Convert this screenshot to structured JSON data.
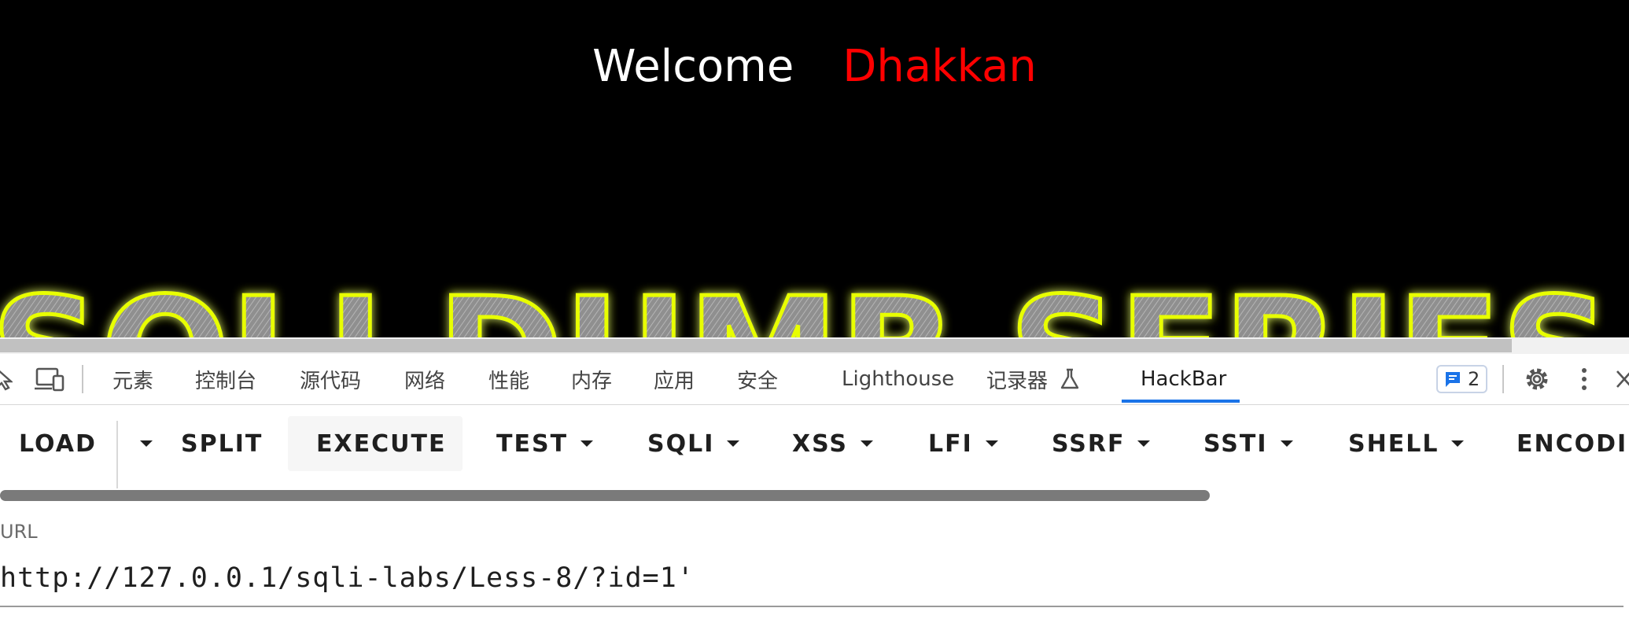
{
  "page": {
    "welcome": "Welcome",
    "name": "Dhakkan",
    "banner_text": "SQLI DUMB SERIES"
  },
  "devtools": {
    "tabs": [
      "元素",
      "控制台",
      "源代码",
      "网络",
      "性能",
      "内存",
      "应用",
      "安全",
      "Lighthouse",
      "记录器",
      "HackBar"
    ],
    "active_tab": "HackBar",
    "issues_count": "2",
    "accent_color": "#1a73e8"
  },
  "hackbar": {
    "buttons": {
      "load": "LOAD",
      "split": "SPLIT",
      "execute": "EXECUTE",
      "test": "TEST",
      "sqli": "SQLI",
      "xss": "XSS",
      "lfi": "LFI",
      "ssrf": "SSRF",
      "ssti": "SSTI",
      "shell": "SHELL",
      "encoding": "ENCODIN"
    },
    "url_label": "URL",
    "url_value": "http://127.0.0.1/sqli-labs/Less-8/?id=1'"
  },
  "colors": {
    "name": "#ff0000",
    "banner_glow": "#e8ff00"
  }
}
